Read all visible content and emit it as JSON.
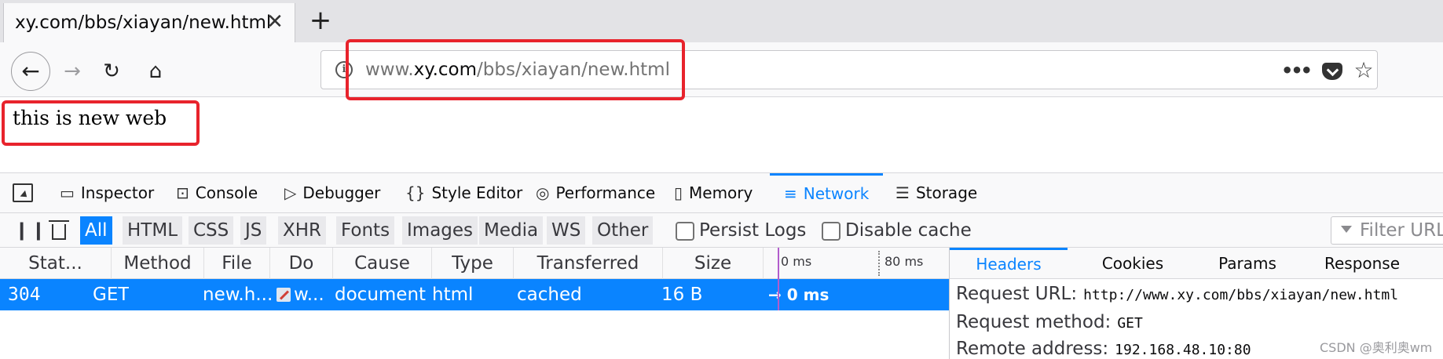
{
  "browser": {
    "tab": {
      "title": "xy.com/bbs/xiayan/new.html",
      "close_glyph": "✕"
    },
    "new_tab_glyph": "+",
    "nav": {
      "back_glyph": "←",
      "forward_glyph": "→",
      "reload_glyph": "↻",
      "home_glyph": "⌂"
    },
    "urlbar": {
      "info_glyph": "i",
      "prefix": "www.",
      "host": "xy.com",
      "path": "/bbs/xiayan/new.html",
      "more_glyph": "•••",
      "star_glyph": "☆"
    }
  },
  "page": {
    "text": "this is new web"
  },
  "devtools": {
    "tabs": [
      {
        "label": "Inspector",
        "icon": "▭"
      },
      {
        "label": "Console",
        "icon": "⊡"
      },
      {
        "label": "Debugger",
        "icon": "▷"
      },
      {
        "label": "Style Editor",
        "icon": "{}"
      },
      {
        "label": "Performance",
        "icon": "◎"
      },
      {
        "label": "Memory",
        "icon": "▯"
      },
      {
        "label": "Network",
        "icon": "≡"
      },
      {
        "label": "Storage",
        "icon": "☰"
      }
    ],
    "active_tab": "Network",
    "filter": {
      "pause_glyph": "❙❙",
      "types": [
        "All",
        "HTML",
        "CSS",
        "JS",
        "XHR",
        "Fonts",
        "Images",
        "Media",
        "WS",
        "Other"
      ],
      "active_type": "All",
      "persist_logs": "Persist Logs",
      "disable_cache": "Disable cache",
      "filter_placeholder": "Filter URLs"
    },
    "columns": [
      "Stat...",
      "Method",
      "File",
      "Do",
      "Cause",
      "Type",
      "Transferred",
      "Size"
    ],
    "timeline_ticks": [
      "0 ms",
      "80 ms"
    ],
    "request": {
      "status": "304",
      "method": "GET",
      "file": "new.h...",
      "domain": "w...",
      "cause": "document",
      "type": "html",
      "transferred": "cached",
      "size": "16 B",
      "timing": "→ 0 ms"
    },
    "details": {
      "tabs": [
        "Headers",
        "Cookies",
        "Params",
        "Response"
      ],
      "active_tab": "Headers",
      "request_url_label": "Request URL:",
      "request_url": "http://www.xy.com/bbs/xiayan/new.html",
      "request_method_label": "Request method:",
      "request_method": "GET",
      "remote_address_label": "Remote address:",
      "remote_address": "192.168.48.10:80"
    }
  },
  "watermark": "CSDN @奥利奥wm",
  "colors": {
    "accent": "#0a84ff",
    "annotation": "#e8232c",
    "selected_row": "#0a84ff"
  }
}
